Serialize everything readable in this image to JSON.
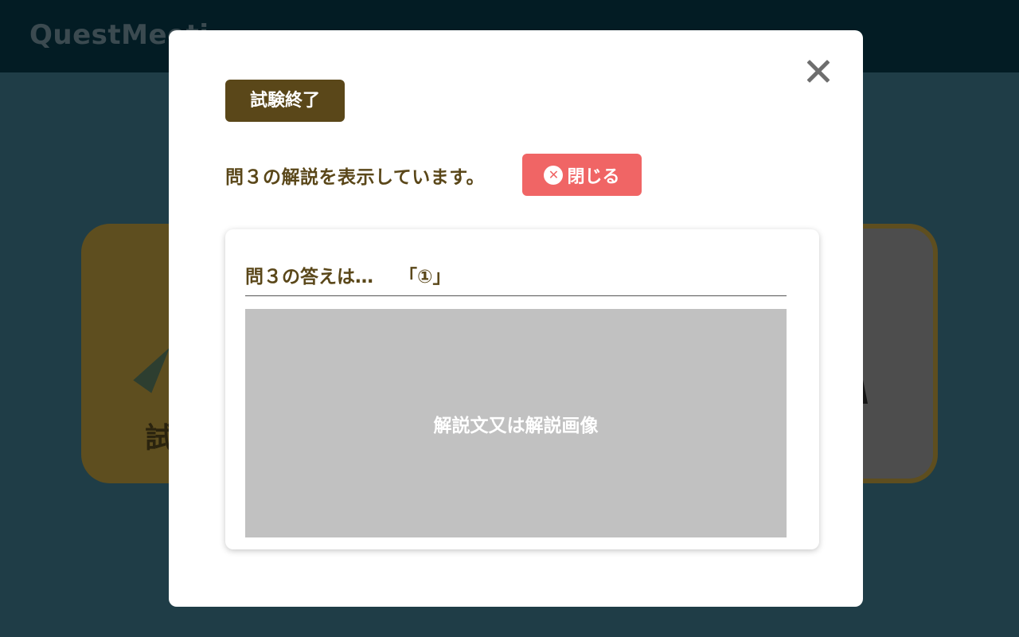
{
  "app": {
    "logo": "QuestMeeti"
  },
  "background": {
    "card_left_text": "試"
  },
  "modal": {
    "badge": "試験終了",
    "status_text": "問３の解説を表示しています。",
    "close_button_label": "閉じる",
    "close_button_icon": "✕",
    "answer_prefix": "問３の答えは…",
    "answer_mark": "「①」",
    "explanation_placeholder": "解説文又は解説画像"
  },
  "colors": {
    "brand_brown": "#5a4719",
    "close_red": "#f06565",
    "overlay": "#1f3d47"
  }
}
